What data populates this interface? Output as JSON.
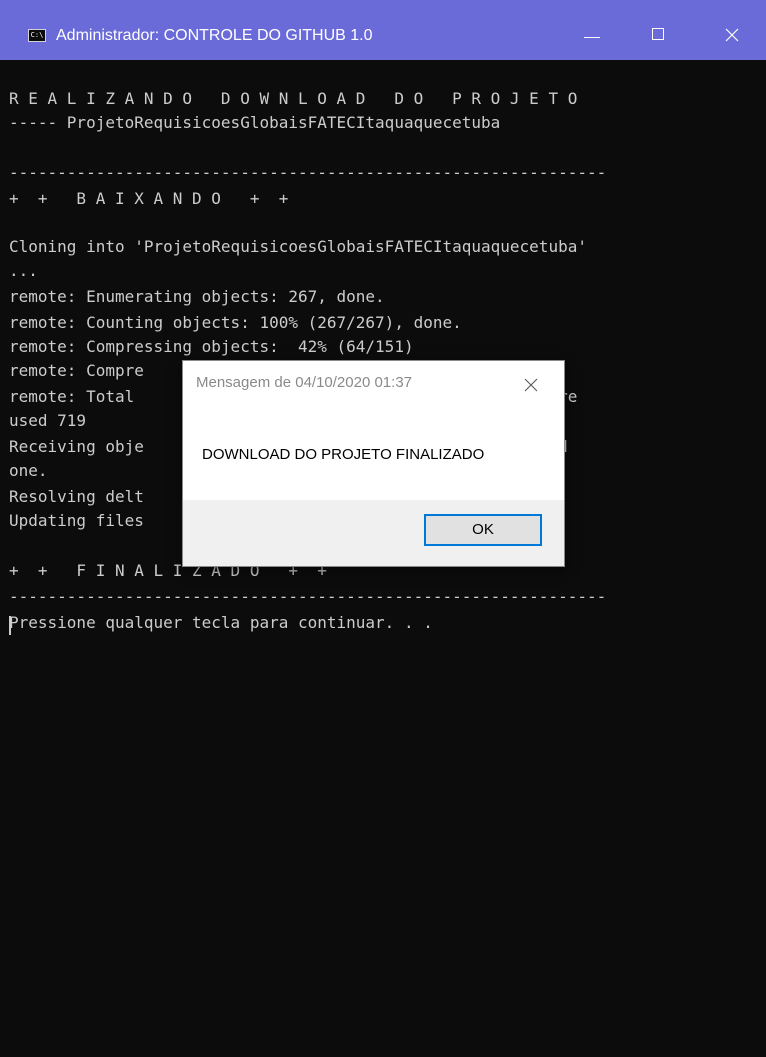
{
  "window": {
    "title": "Administrador:  CONTROLE DO GITHUB 1.0",
    "icon": "cmd-icon",
    "controls": [
      "minimize-icon",
      "maximize-icon",
      "close-icon"
    ],
    "titlebar_color": "#6a6bd9"
  },
  "console": {
    "lines": [
      "R E A L I Z A N D O   D O W N L O A D   D O   P R O J E T O",
      "----- ProjetoRequisicoesGlobaisFATECItaquaquecetuba",
      "",
      "--------------------------------------------------------------",
      "+  +   B A I X A N D O   +  +",
      "",
      "Cloning into 'ProjetoRequisicoesGlobaisFATECItaquaquecetuba'",
      "...",
      "remote: Enumerating objects: 267, done.",
      "remote: Counting objects: 100% (267/267), done.",
      "remote: Compressing objects:  42% (64/151)",
      "remote: Compre                             done.",
      "remote: Total                              lta 69), pack-re",
      "used 719",
      "Receiving obje                             | 1.19 MiB/s, d",
      "one.",
      "Resolving delt",
      "Updating files",
      "",
      "+  +   F I N A L I Z A D O   +  +",
      "--------------------------------------------------------------",
      "Pressione qualquer tecla para continuar. . ."
    ]
  },
  "dialog": {
    "title": "Mensagem de  04/10/2020 01:37",
    "message": "DOWNLOAD DO PROJETO FINALIZADO",
    "ok_label": "OK"
  }
}
